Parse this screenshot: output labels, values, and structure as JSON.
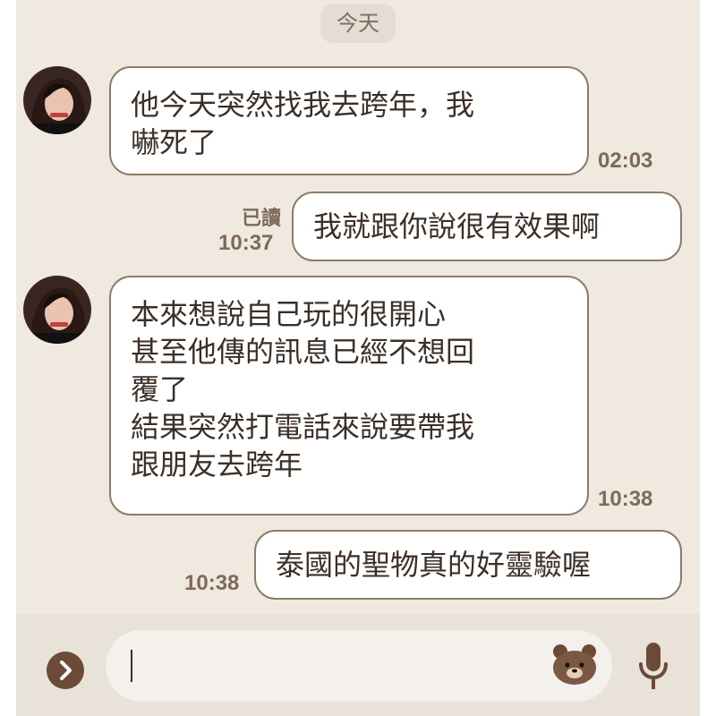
{
  "chat": {
    "date_label": "今天",
    "messages": [
      {
        "sender": "other",
        "text": "他今天突然找我去跨年，我\n嚇死了",
        "time": "02:03"
      },
      {
        "sender": "me",
        "read_label": "已讀",
        "text": "我就跟你說很有效果啊",
        "time": "10:37"
      },
      {
        "sender": "other",
        "text": "本來想說自己玩的很開心\n甚至他傳的訊息已經不想回\n覆了\n結果突然打電話來說要帶我\n跟朋友去跨年",
        "time": "10:38"
      },
      {
        "sender": "me",
        "text": "泰國的聖物真的好靈驗喔",
        "time": "10:38"
      }
    ]
  },
  "input_bar": {
    "value": "",
    "icons": [
      "chevron-right-icon",
      "bear-sticker-icon",
      "microphone-icon"
    ]
  },
  "colors": {
    "chat_background": "#efe9e0",
    "bubble_border": "#8e7b6a",
    "timestamp": "#7d6a58",
    "input_bar": "#e9e2d8",
    "accent_brown": "#6a4b38"
  }
}
